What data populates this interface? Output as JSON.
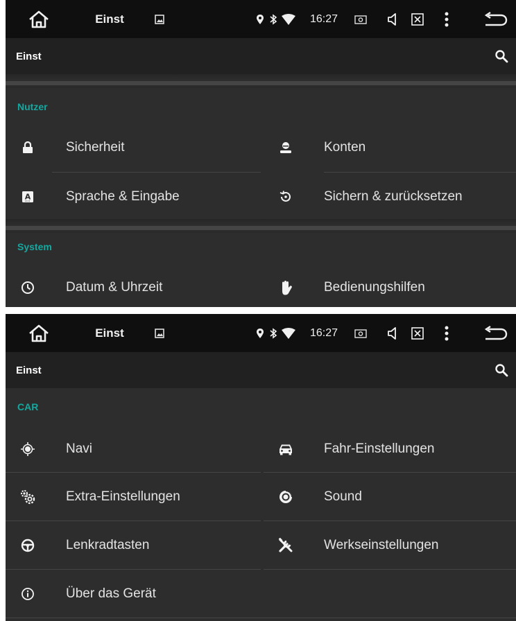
{
  "status_bar": {
    "title": "Einst",
    "time": "16:27"
  },
  "toolbar": {
    "title": "Einst"
  },
  "top_screen": {
    "categories": [
      {
        "label": "Nutzer",
        "items": [
          {
            "label": "Sicherheit",
            "icon": "lock-icon"
          },
          {
            "label": "Konten",
            "icon": "account-icon"
          },
          {
            "label": "Sprache & Eingabe",
            "icon": "language-icon"
          },
          {
            "label": "Sichern & zurücksetzen",
            "icon": "restore-icon"
          }
        ]
      },
      {
        "label": "System",
        "items": [
          {
            "label": "Datum & Uhrzeit",
            "icon": "clock-icon"
          },
          {
            "label": "Bedienungshilfen",
            "icon": "hand-icon"
          }
        ]
      }
    ]
  },
  "bottom_screen": {
    "categories": [
      {
        "label": "CAR",
        "items": [
          {
            "label": "Navi",
            "icon": "gps-icon"
          },
          {
            "label": "Fahr-Einstellungen",
            "icon": "car-icon"
          },
          {
            "label": "Extra-Einstellungen",
            "icon": "gears-icon"
          },
          {
            "label": "Sound",
            "icon": "speaker-icon"
          },
          {
            "label": "Lenkradtasten",
            "icon": "steering-wheel-icon"
          },
          {
            "label": "Werkseinstellungen",
            "icon": "tools-icon"
          },
          {
            "label": "Über das Gerät",
            "icon": "info-icon"
          }
        ]
      }
    ]
  }
}
